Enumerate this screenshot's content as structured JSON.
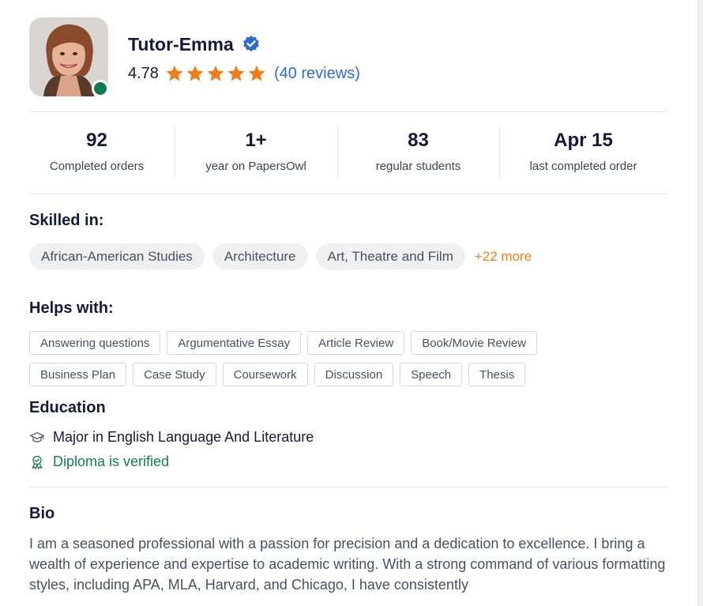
{
  "profile": {
    "name": "Tutor-Emma",
    "rating": "4.78",
    "stars": 5,
    "reviews": "(40 reviews)",
    "online_color": "#0f7a4a",
    "verified_icon": "verified-badge-icon"
  },
  "stats": [
    {
      "value": "92",
      "label": "Completed orders"
    },
    {
      "value": "1+",
      "label": "year on PapersOwl"
    },
    {
      "value": "83",
      "label": "regular students"
    },
    {
      "value": "Apr 15",
      "label": "last completed order"
    }
  ],
  "skills": {
    "title": "Skilled in:",
    "items": [
      "African-American Studies",
      "Architecture",
      "Art, Theatre and Film"
    ],
    "more": "+22 more"
  },
  "helps": {
    "title": "Helps with:",
    "items": [
      "Answering questions",
      "Argumentative Essay",
      "Article Review",
      "Book/Movie Review",
      "Business Plan",
      "Case Study",
      "Coursework",
      "Discussion",
      "Speech",
      "Thesis"
    ]
  },
  "education": {
    "title": "Education",
    "major": "Major in English Language And Literature",
    "diploma": "Diploma is verified"
  },
  "bio": {
    "title": "Bio",
    "text": "I am a seasoned professional with a passion for precision and a dedication to excellence. I bring a wealth of experience and expertise to academic writing. With a strong command of various formatting styles, including APA, MLA, Harvard, and Chicago, I have consistently"
  },
  "colors": {
    "accent_blue": "#2d6bd0",
    "star_orange": "#f07c1c",
    "verified_green": "#12804f"
  }
}
